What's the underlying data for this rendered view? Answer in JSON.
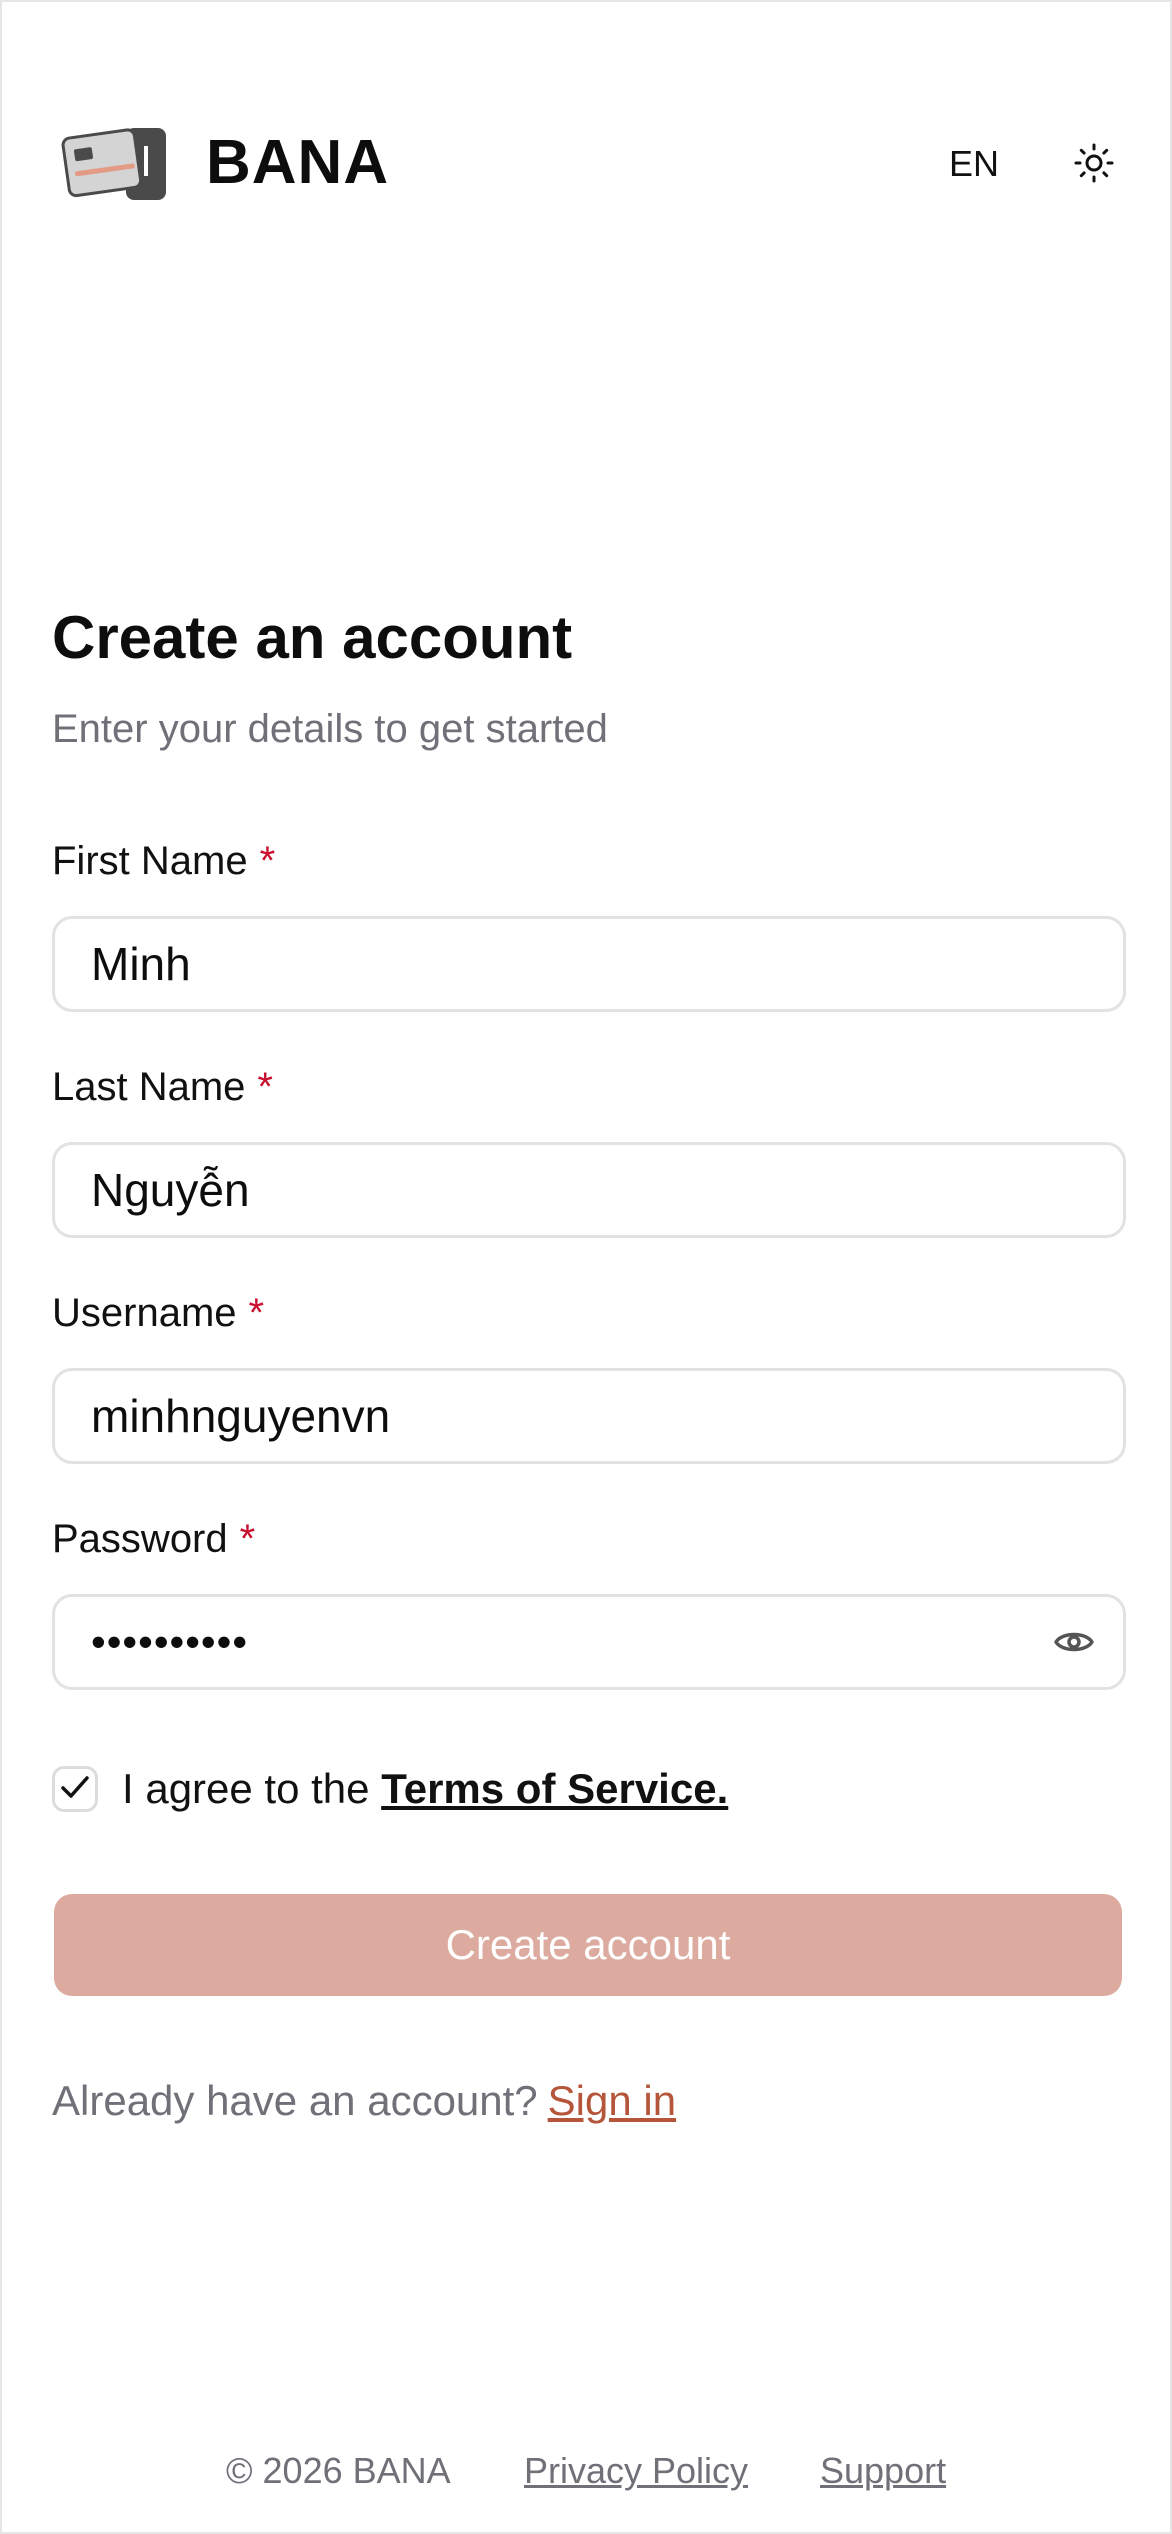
{
  "header": {
    "brand": "BANA",
    "language": "EN",
    "logo_icon": "card-wallet-icon",
    "theme_icon": "sun-icon"
  },
  "form": {
    "title": "Create an account",
    "subtitle": "Enter your details to get started",
    "required_marker": "*",
    "fields": [
      {
        "label": "First Name",
        "value": "Minh"
      },
      {
        "label": "Last Name",
        "value": "Nguyễn"
      },
      {
        "label": "Username",
        "value": "minhnguyenvn"
      },
      {
        "label": "Password",
        "value": "••••••••••",
        "toggle_icon": "eye-icon"
      }
    ],
    "agree": {
      "checked": true,
      "text": "I agree to the ",
      "terms_link": "Terms of Service."
    },
    "submit_label": "Create account",
    "signin": {
      "text": "Already have an account?",
      "link": "Sign in"
    }
  },
  "footer": {
    "copyright": "© 2026 BANA",
    "privacy": "Privacy Policy",
    "support": "Support"
  },
  "colors": {
    "accent": "#b5553a",
    "button_bg": "#dcaa9e",
    "required": "#c8102e",
    "muted_text": "#6f7078",
    "border": "#e2e2e4"
  }
}
